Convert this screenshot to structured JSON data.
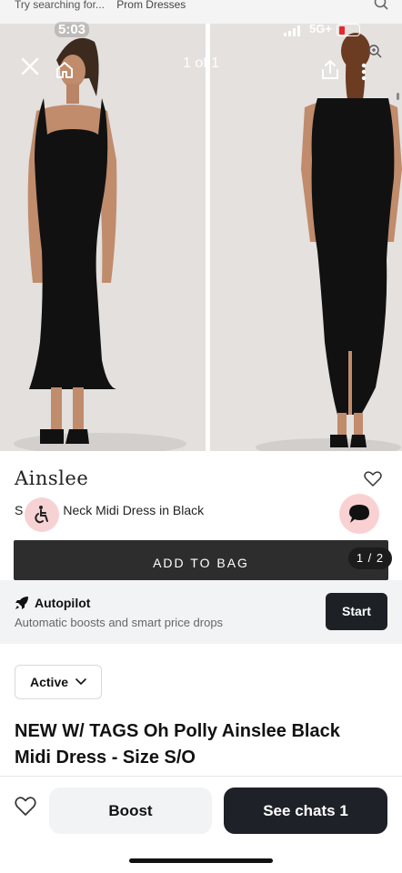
{
  "search": {
    "placeholder": "Try searching for...",
    "suggestion": "Prom Dresses"
  },
  "status_bar": {
    "time": "5:03",
    "network": "5G+"
  },
  "viewer": {
    "page_counter": "1 of 1",
    "icons": [
      "close-icon",
      "home-icon",
      "share-icon",
      "more-icon",
      "zoom-icon"
    ]
  },
  "product": {
    "brand": "Ainslee",
    "subtitle_start": "S",
    "subtitle_end": "Neck Midi Dress in Black",
    "add_to_bag": "ADD TO BAG",
    "image_pager": "1 / 2"
  },
  "autopilot": {
    "title": "Autopilot",
    "description": "Automatic boosts and smart price drops",
    "start_label": "Start"
  },
  "listing": {
    "status": "Active",
    "title": "NEW W/ TAGS Oh Polly Ainslee Black Midi Dress - Size S/O"
  },
  "actions": {
    "boost_label": "Boost",
    "chats_label": "See chats 1"
  },
  "colors": {
    "dark_button": "#1e2127",
    "chat_bubble_bg": "#fad1d3",
    "battery_low": "#e8282c"
  }
}
